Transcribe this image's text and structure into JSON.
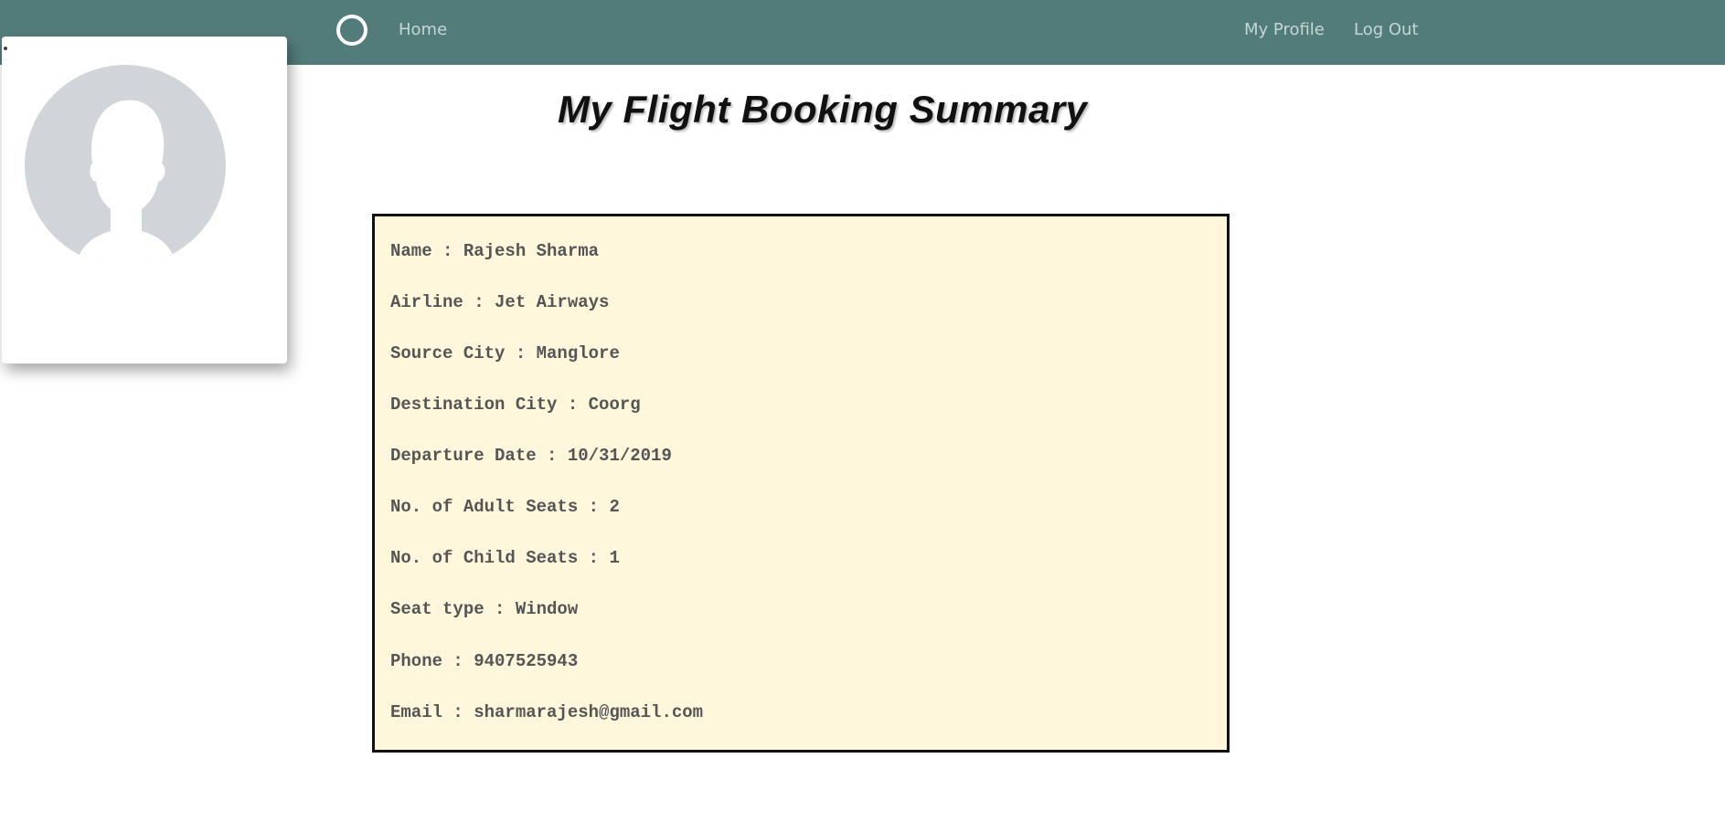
{
  "nav": {
    "home_label": "Home",
    "profile_label": "My Profile",
    "logout_label": "Log Out"
  },
  "page": {
    "title": "My Flight Booking Summary"
  },
  "summary": {
    "lines": [
      "Name : Rajesh Sharma",
      "Airline : Jet Airways",
      "Source City : Manglore",
      "Destination City : Coorg",
      "Departure Date : 10/31/2019",
      "No. of Adult Seats : 2",
      "No. of Child Seats : 1",
      "Seat type : Window",
      "Phone : 9407525943",
      "Email : sharmarajesh@gmail.com"
    ]
  },
  "icons": {
    "logo": "circle-logo-icon",
    "avatar": "avatar-placeholder-icon"
  },
  "colors": {
    "navbar": "#527c7a",
    "nav_text": "#c5d6d5",
    "summary_background": "#fff7dc",
    "summary_border": "#111111",
    "summary_text": "#555555"
  }
}
